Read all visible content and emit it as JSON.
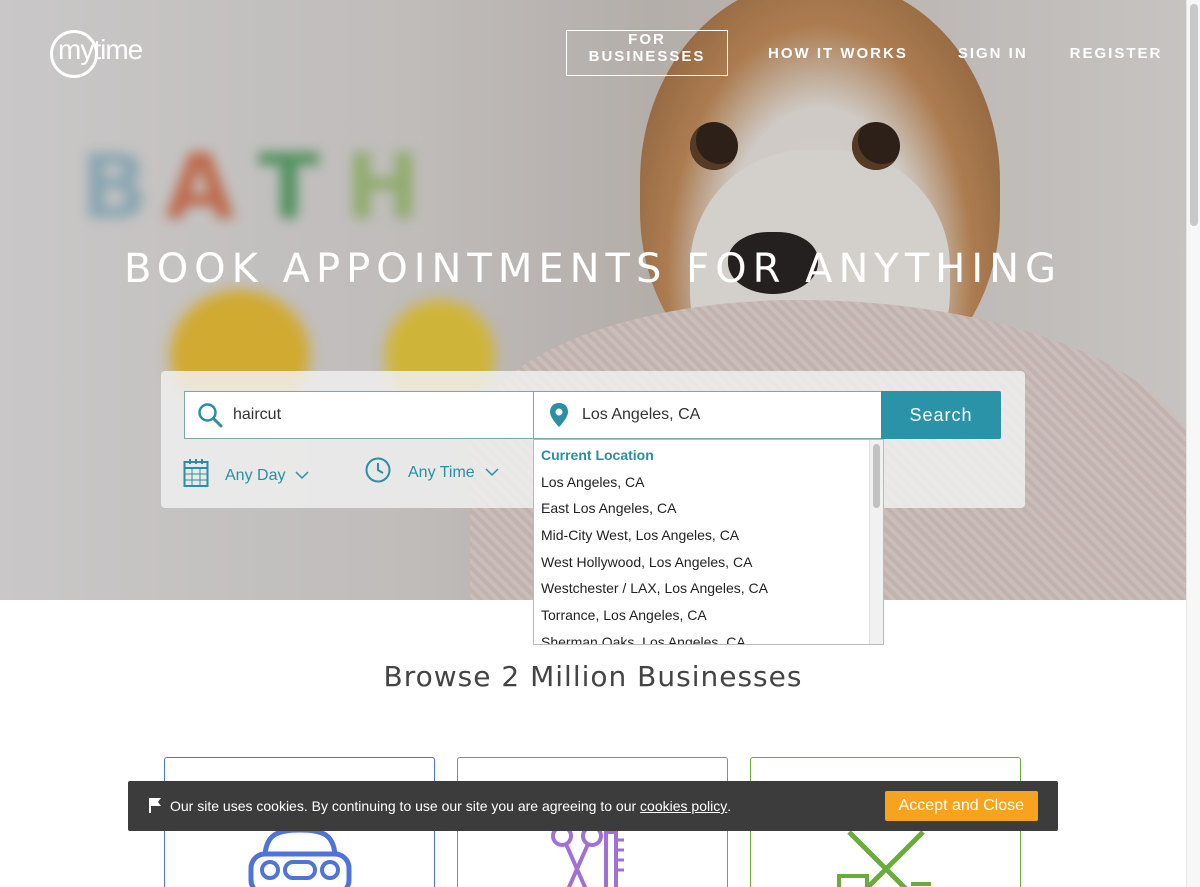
{
  "brand": {
    "logo_text": "mytime"
  },
  "nav": {
    "for_businesses": "FOR BUSINESSES",
    "how_it_works": "HOW IT WORKS",
    "sign_in": "SIGN IN",
    "register": "REGISTER"
  },
  "hero": {
    "title": "BOOK APPOINTMENTS FOR ANYTHING",
    "background_letters": [
      "B",
      "A",
      "T",
      "H"
    ]
  },
  "search": {
    "what_value": "haircut",
    "where_value": "Los Angeles, CA",
    "button_label": "Search",
    "day_filter": "Any Day",
    "time_filter": "Any Time",
    "accent_color": "#2a93a7"
  },
  "location_dropdown": {
    "items": [
      "Current Location",
      "Los Angeles, CA",
      "East Los Angeles, CA",
      "Mid-City West, Los Angeles, CA",
      "West Hollywood, Los Angeles, CA",
      "Westchester / LAX, Los Angeles, CA",
      "Torrance, Los Angeles, CA",
      "Sherman Oaks, Los Angeles, CA"
    ]
  },
  "browse": {
    "title": "Browse 2 Million Businesses",
    "categories": [
      {
        "icon": "car-icon",
        "color": "#4f74d8"
      },
      {
        "icon": "scissors-comb-icon",
        "color": "#a070d6"
      },
      {
        "icon": "grooming-tools-icon",
        "color": "#6aac3a"
      }
    ]
  },
  "cookie_bar": {
    "text": "Our site uses cookies. By continuing to use our site you are agreeing to our",
    "link": "cookies policy",
    "suffix": ".",
    "accept_label": "Accept and Close",
    "accept_color": "#f7a31d"
  }
}
